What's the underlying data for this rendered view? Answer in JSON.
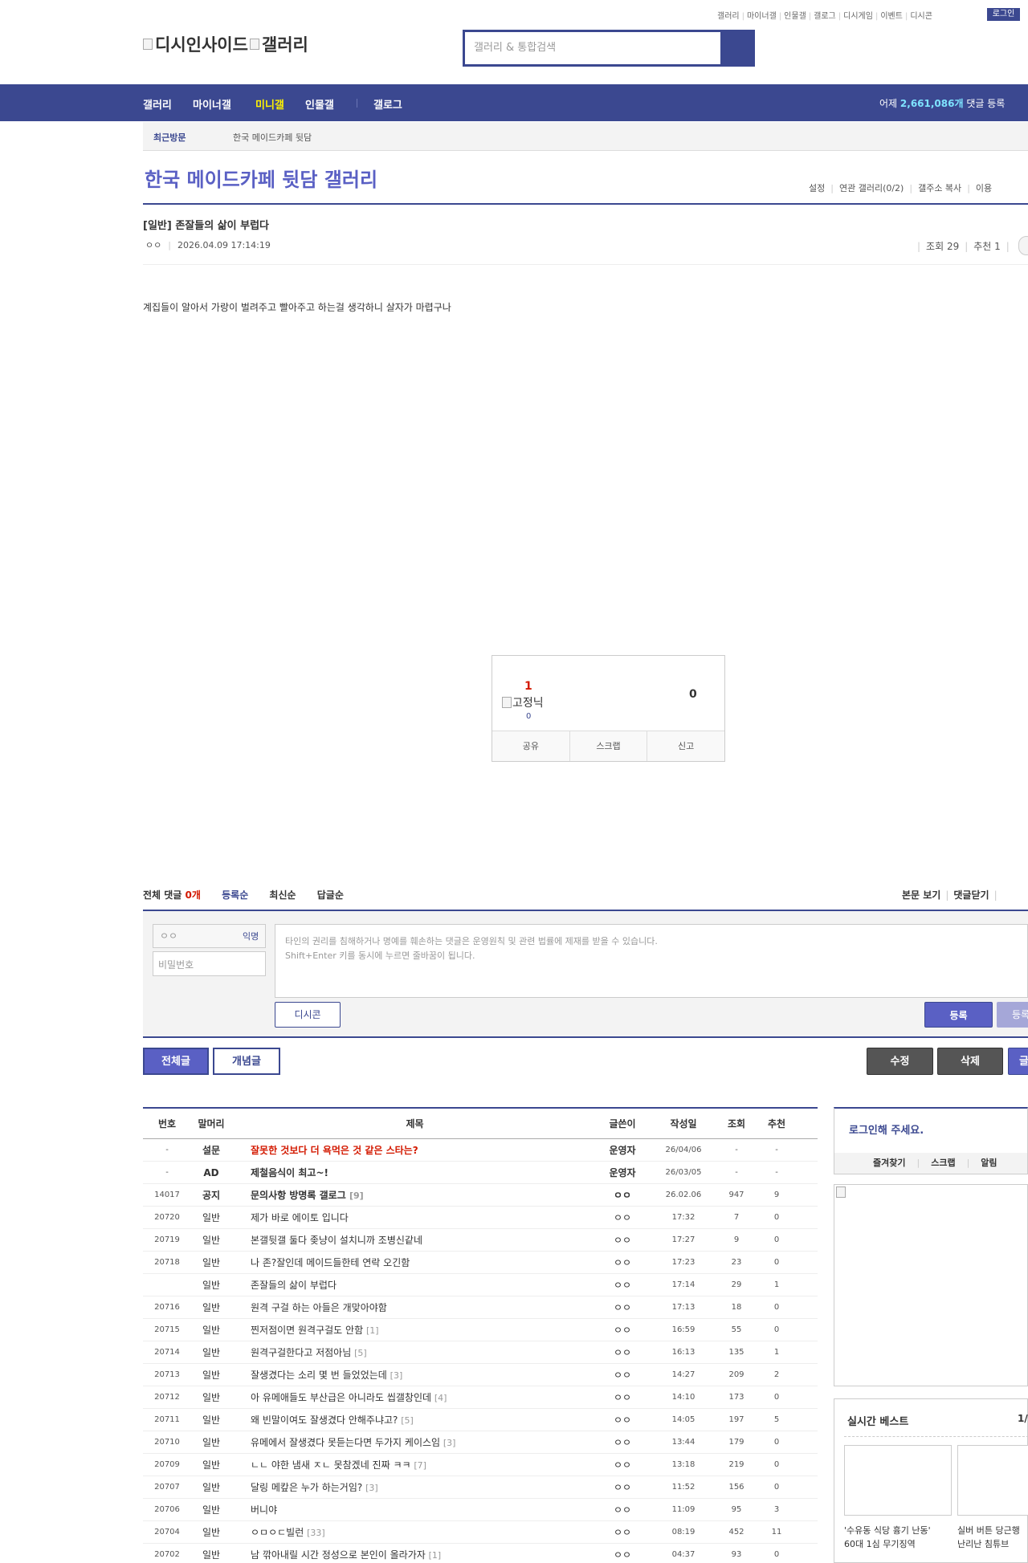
{
  "top_links": [
    "갤러리",
    "마이너갤",
    "인물갤",
    "갤로그",
    "디시게임",
    "이벤트",
    "디시콘"
  ],
  "login_label": "로그인",
  "logo_alt_1": "디시인사이드",
  "logo_alt_2": "갤러리",
  "search_placeholder": "갤러리 & 통합검색",
  "nav": {
    "items": [
      "갤러리",
      "마이너갤",
      "미니갤",
      "인물갤",
      "갤로그"
    ],
    "active": "미니갤",
    "right_prefix": "어제 ",
    "right_count": "2,661,086개",
    "right_suffix": " 댓글 등록"
  },
  "recent": {
    "label": "최근방문",
    "item": "한국 메이드카페 뒷담"
  },
  "gallery": {
    "title": "한국 메이드카페 뒷담 갤러리",
    "tools": [
      "설정",
      "연관 갤러리(0/2)",
      "갤주소 복사",
      "이용"
    ]
  },
  "post": {
    "title": "[일반] 존잘들의 삶이 부럽다",
    "author": "ㅇㅇ",
    "datetime": "2026.04.09 17:14:19",
    "views": "조회 29",
    "recommends": "추천 1",
    "body": "계집들이 알아서 가랑이 벌려주고 빨아주고 하는걸 생각하니 살자가 마렵구나"
  },
  "vote": {
    "up": "1",
    "img_alt": "고정닉",
    "fixed_count": "0",
    "down": "0",
    "buttons": [
      "공유",
      "스크랩",
      "신고"
    ]
  },
  "comments": {
    "label": "전체 댓글 ",
    "count": "0개",
    "sorts": [
      "등록순",
      "최신순",
      "답글순"
    ],
    "right": [
      "본문 보기",
      "댓글닫기"
    ],
    "nick": "ㅇㅇ",
    "nick_tag": "익명",
    "password_placeholder": "비밀번호",
    "notice_line1": "타인의 권리를 침해하거나 명예를 훼손하는 댓글은 운영원칙 및 관련 법률에 제재를 받을 수 있습니다.",
    "notice_line2": "Shift+Enter 키를 동시에 누르면 줄바꿈이 됩니다.",
    "dccon": "디시콘",
    "submit": "등록",
    "submit2": "등록"
  },
  "tabs": {
    "all": "전체글",
    "concept": "개념글"
  },
  "actions": {
    "edit": "수정",
    "delete": "삭제",
    "write": "글"
  },
  "list": {
    "headers": [
      "번호",
      "말머리",
      "제목",
      "글쓴이",
      "작성일",
      "조회",
      "추천"
    ],
    "rows": [
      {
        "no": "-",
        "head": "설문",
        "title": "잘못한 것보다 더 욕먹은 것 같은 스타는?",
        "rep": "",
        "writer": "운영자",
        "date": "26/04/06",
        "views": "-",
        "rec": "-",
        "type": "survey"
      },
      {
        "no": "-",
        "head": "AD",
        "title": "제철음식이 최고~!",
        "rep": "",
        "writer": "운영자",
        "date": "26/03/05",
        "views": "-",
        "rec": "-",
        "type": "notice"
      },
      {
        "no": "14017",
        "head": "공지",
        "title": "문의사항 방명록 갤로그",
        "rep": "[9]",
        "writer": "ㅇㅇ",
        "date": "26.02.06",
        "views": "947",
        "rec": "9",
        "type": "notice"
      },
      {
        "no": "20720",
        "head": "일반",
        "title": "제가 바로 에이토 입니다",
        "rep": "",
        "writer": "ㅇㅇ",
        "date": "17:32",
        "views": "7",
        "rec": "0",
        "type": "normal"
      },
      {
        "no": "20719",
        "head": "일반",
        "title": "본갤뒷갤 둘다 좆냥이 설치니까 조병신같네",
        "rep": "",
        "writer": "ㅇㅇ",
        "date": "17:27",
        "views": "9",
        "rec": "0",
        "type": "normal"
      },
      {
        "no": "20718",
        "head": "일반",
        "title": "나 존?잘인데 메이드들한테 연락 오긴함",
        "rep": "",
        "writer": "ㅇㅇ",
        "date": "17:23",
        "views": "23",
        "rec": "0",
        "type": "normal"
      },
      {
        "no": "",
        "head": "일반",
        "title": "존잘들의 삶이 부럽다",
        "rep": "",
        "writer": "ㅇㅇ",
        "date": "17:14",
        "views": "29",
        "rec": "1",
        "type": "normal"
      },
      {
        "no": "20716",
        "head": "일반",
        "title": "원격 구걸 하는 아들은 개맞아야함",
        "rep": "",
        "writer": "ㅇㅇ",
        "date": "17:13",
        "views": "18",
        "rec": "0",
        "type": "normal"
      },
      {
        "no": "20715",
        "head": "일반",
        "title": "찐저점이면 원격구걸도 안함",
        "rep": "[1]",
        "writer": "ㅇㅇ",
        "date": "16:59",
        "views": "55",
        "rec": "0",
        "type": "normal"
      },
      {
        "no": "20714",
        "head": "일반",
        "title": "원격구걸한다고 저점아님",
        "rep": "[5]",
        "writer": "ㅇㅇ",
        "date": "16:13",
        "views": "135",
        "rec": "1",
        "type": "normal"
      },
      {
        "no": "20713",
        "head": "일반",
        "title": "잘생겼다는 소리 몇 번 들었었는데",
        "rep": "[3]",
        "writer": "ㅇㅇ",
        "date": "14:27",
        "views": "209",
        "rec": "2",
        "type": "normal"
      },
      {
        "no": "20712",
        "head": "일반",
        "title": "아 유메애들도 부산급은 아니라도 씹갤창인데",
        "rep": "[4]",
        "writer": "ㅇㅇ",
        "date": "14:10",
        "views": "173",
        "rec": "0",
        "type": "normal"
      },
      {
        "no": "20711",
        "head": "일반",
        "title": "왜 빈말이여도 잘생겼다 안해주냐고?",
        "rep": "[5]",
        "writer": "ㅇㅇ",
        "date": "14:05",
        "views": "197",
        "rec": "5",
        "type": "normal"
      },
      {
        "no": "20710",
        "head": "일반",
        "title": "유메에서 잘생겼다 못듣는다면 두가지 케이스임",
        "rep": "[3]",
        "writer": "ㅇㅇ",
        "date": "13:44",
        "views": "179",
        "rec": "0",
        "type": "normal"
      },
      {
        "no": "20709",
        "head": "일반",
        "title": "ㄴㄴ 야한 냄새 ㅈㄴ 못참겠네 진짜 ㅋㅋ",
        "rep": "[7]",
        "writer": "ㅇㅇ",
        "date": "13:18",
        "views": "219",
        "rec": "0",
        "type": "normal"
      },
      {
        "no": "20707",
        "head": "일반",
        "title": "달링 메캎은 누가 하는거임?",
        "rep": "[3]",
        "writer": "ㅇㅇ",
        "date": "11:52",
        "views": "156",
        "rec": "0",
        "type": "normal"
      },
      {
        "no": "20706",
        "head": "일반",
        "title": "버니야",
        "rep": "",
        "writer": "ㅇㅇ",
        "date": "11:09",
        "views": "95",
        "rec": "3",
        "type": "normal"
      },
      {
        "no": "20704",
        "head": "일반",
        "title": "ㅇㅁㅇㄷ빌런",
        "rep": "[33]",
        "writer": "ㅇㅇ",
        "date": "08:19",
        "views": "452",
        "rec": "11",
        "type": "normal"
      },
      {
        "no": "20702",
        "head": "일반",
        "title": "남 깎아내릴 시간 정성으로 본인이 올라가자",
        "rep": "[1]",
        "writer": "ㅇㅇ",
        "date": "04:37",
        "views": "93",
        "rec": "0",
        "type": "normal"
      }
    ]
  },
  "sidebar": {
    "login_title": "로그인해 주세요.",
    "login_links": [
      "즐겨찾기",
      "스크랩",
      "알림"
    ],
    "best_title": "실시간 베스트",
    "best_page": "1/",
    "best_items": [
      {
        "line1": "'수유동 식당 흉기 난동'",
        "line2": "60대 1심 무기징역"
      },
      {
        "line1": "실버 버튼 당근행",
        "line2": "난리난 침튜브"
      }
    ]
  }
}
